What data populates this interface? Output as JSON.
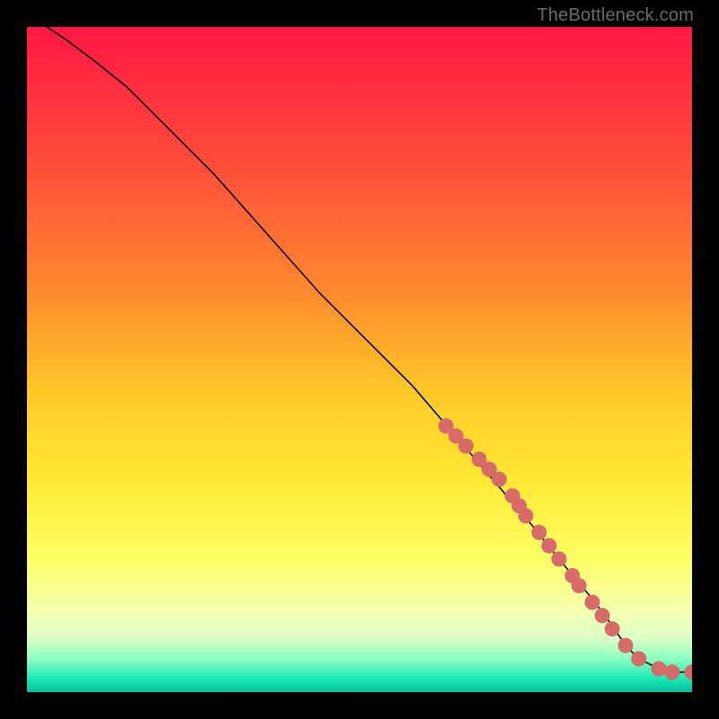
{
  "watermark": "TheBottleneck.com",
  "colors": {
    "black": "#000000",
    "marker_fill": "#d86a6a",
    "marker_stroke": "#b45050",
    "line": "#000000"
  },
  "chart_data": {
    "type": "line",
    "title": "",
    "xlabel": "",
    "ylabel": "",
    "xlim": [
      0,
      100
    ],
    "ylim": [
      0,
      100
    ],
    "gradient_stops": [
      {
        "offset": 0,
        "color": "#ff1744"
      },
      {
        "offset": 20,
        "color": "#ff4b3a"
      },
      {
        "offset": 40,
        "color": "#ff8a2e"
      },
      {
        "offset": 55,
        "color": "#ffc928"
      },
      {
        "offset": 68,
        "color": "#ffe833"
      },
      {
        "offset": 80,
        "color": "#fdff65"
      },
      {
        "offset": 88,
        "color": "#f3ffb0"
      },
      {
        "offset": 92,
        "color": "#dbffc8"
      },
      {
        "offset": 95,
        "color": "#8affc0"
      },
      {
        "offset": 98,
        "color": "#1de9b6"
      },
      {
        "offset": 100,
        "color": "#00c29a"
      }
    ],
    "series": [
      {
        "name": "curve",
        "x": [
          3,
          6,
          10,
          15,
          20,
          28,
          36,
          44,
          52,
          58,
          64,
          70,
          76,
          80,
          85,
          88,
          90,
          92,
          94,
          96,
          98,
          100
        ],
        "y": [
          100,
          98,
          95,
          91,
          86,
          78,
          69,
          60,
          52,
          46,
          39,
          32,
          25,
          20,
          14,
          10,
          7,
          5,
          4,
          3,
          3,
          3
        ]
      }
    ],
    "markers": [
      {
        "x": 63,
        "y": 40
      },
      {
        "x": 64.5,
        "y": 38.5
      },
      {
        "x": 66,
        "y": 37
      },
      {
        "x": 68,
        "y": 35
      },
      {
        "x": 69.5,
        "y": 33.5
      },
      {
        "x": 71,
        "y": 32
      },
      {
        "x": 73,
        "y": 29.5
      },
      {
        "x": 74,
        "y": 28
      },
      {
        "x": 75,
        "y": 26.5
      },
      {
        "x": 77,
        "y": 24
      },
      {
        "x": 78.5,
        "y": 22
      },
      {
        "x": 80,
        "y": 20
      },
      {
        "x": 82,
        "y": 17.5
      },
      {
        "x": 83,
        "y": 16
      },
      {
        "x": 85,
        "y": 13.5
      },
      {
        "x": 86.5,
        "y": 11.5
      },
      {
        "x": 88,
        "y": 9.5
      },
      {
        "x": 90,
        "y": 7
      },
      {
        "x": 92,
        "y": 5
      },
      {
        "x": 95,
        "y": 3.5
      },
      {
        "x": 97,
        "y": 3
      },
      {
        "x": 100,
        "y": 3
      }
    ]
  }
}
